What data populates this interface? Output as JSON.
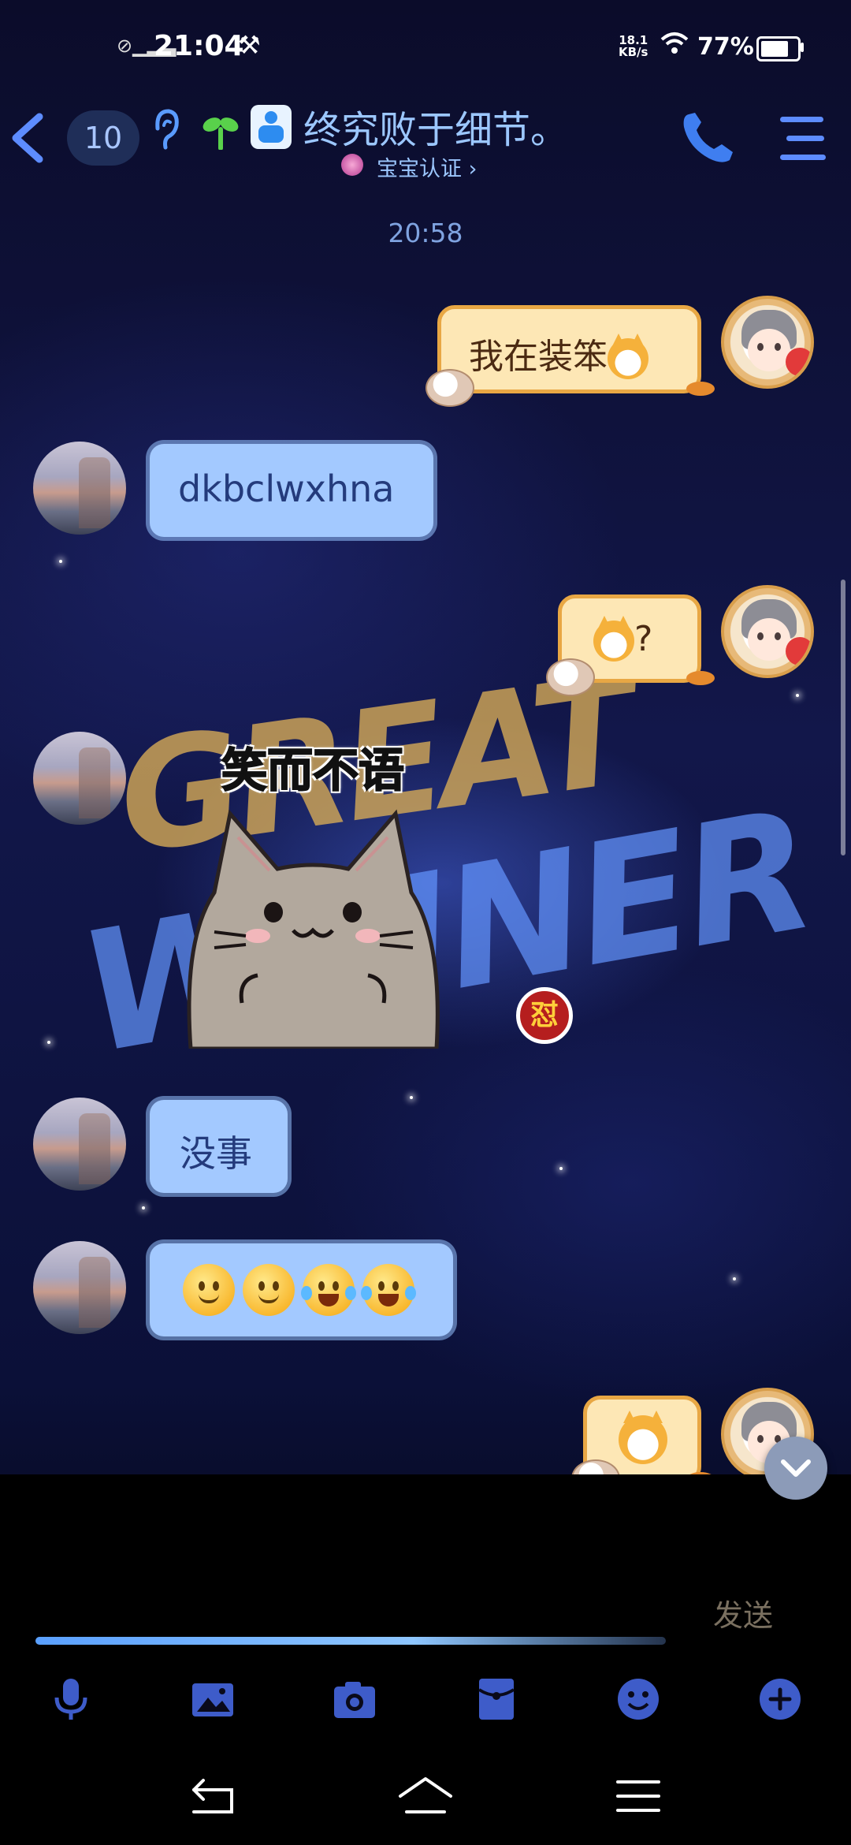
{
  "status_bar": {
    "time": "21:04",
    "net_speed_value": "18.1",
    "net_speed_unit": "KB/s",
    "battery": "77%",
    "battery_level": 0.77
  },
  "header": {
    "unread_badge": "10",
    "contact_name": "终究败于细节。",
    "certification": "宝宝认证 ›"
  },
  "chat": {
    "timestamp": "20:58",
    "messages": [
      {
        "from": "me",
        "text": "我在装笨"
      },
      {
        "from": "peer",
        "text": "dkbclwxhna"
      },
      {
        "from": "me",
        "text": "?"
      },
      {
        "from": "peer",
        "type": "sticker",
        "caption": "笑而不语"
      },
      {
        "from": "peer",
        "text": "没事"
      },
      {
        "from": "peer",
        "type": "emoji_row",
        "emojis": [
          "slight-smile",
          "slight-smile",
          "tears-of-joy",
          "tears-of-joy"
        ]
      },
      {
        "from": "me",
        "type": "doge_emoji"
      }
    ],
    "stamp_glyph": "怼"
  },
  "input_bar": {
    "send_label": "发送"
  },
  "toolbar": {
    "items": [
      "microphone-icon",
      "image-icon",
      "camera-icon",
      "red-packet-icon",
      "emoji-icon",
      "plus-icon"
    ]
  },
  "colors": {
    "accent_blue": "#5d8cff",
    "my_bubble": "#fde7b5",
    "peer_bubble": "#a3c9ff"
  }
}
